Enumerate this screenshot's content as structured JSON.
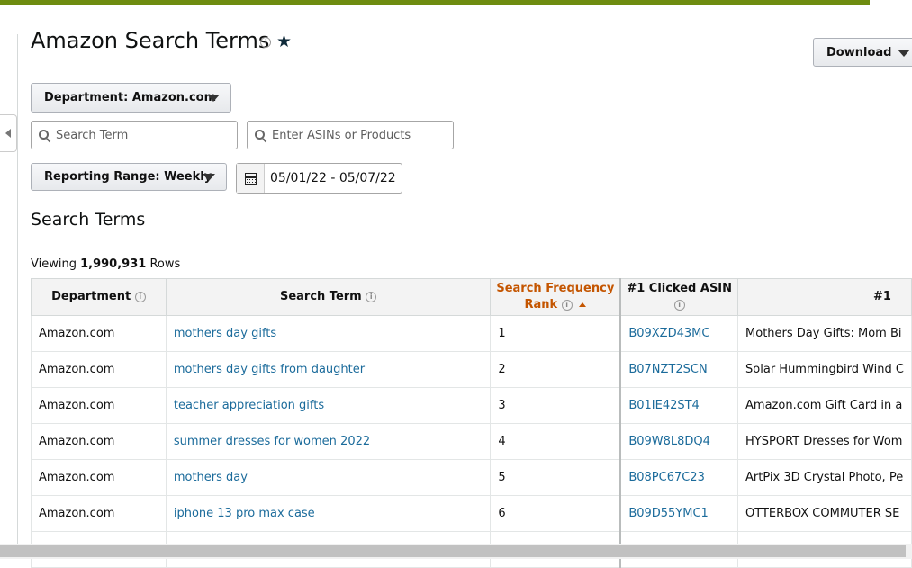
{
  "page": {
    "title": "Amazon Search Terms",
    "info_glyph": "i",
    "star_glyph": "★"
  },
  "toolbar": {
    "download_label": "Download"
  },
  "filters": {
    "department_label": "Department: Amazon.com",
    "search_term_placeholder": "Search Term",
    "asin_placeholder": "Enter ASINs or Products",
    "reporting_range_label": "Reporting Range: Weekly",
    "date_range": "05/01/22 - 05/07/22"
  },
  "section": {
    "title": "Search Terms",
    "viewing_prefix": "Viewing",
    "row_count": "1,990,931",
    "viewing_suffix": "Rows"
  },
  "table": {
    "headers": {
      "department": "Department",
      "search_term": "Search Term",
      "sfr_line1": "Search Frequency",
      "sfr_line2": "Rank",
      "clicked_asin": "#1 Clicked ASIN",
      "next_col": "#1"
    },
    "rows": [
      {
        "department": "Amazon.com",
        "term": "mothers day gifts",
        "rank": "1",
        "asin": "B09XZD43MC",
        "title": "Mothers Day Gifts: Mom Bi"
      },
      {
        "department": "Amazon.com",
        "term": "mothers day gifts from daughter",
        "rank": "2",
        "asin": "B07NZT2SCN",
        "title": "Solar Hummingbird Wind C"
      },
      {
        "department": "Amazon.com",
        "term": "teacher appreciation gifts",
        "rank": "3",
        "asin": "B01IE42ST4",
        "title": "Amazon.com Gift Card in a"
      },
      {
        "department": "Amazon.com",
        "term": "summer dresses for women 2022",
        "rank": "4",
        "asin": "B09W8L8DQ4",
        "title": "HYSPORT Dresses for Wom"
      },
      {
        "department": "Amazon.com",
        "term": "mothers day",
        "rank": "5",
        "asin": "B08PC67C23",
        "title": "ArtPix 3D Crystal Photo, Pe"
      },
      {
        "department": "Amazon.com",
        "term": "iphone 13 pro max case",
        "rank": "6",
        "asin": "B09D55YMC1",
        "title": "OTTERBOX COMMUTER SE"
      }
    ]
  },
  "colors": {
    "brand_bar": "#6e8c10",
    "link": "#1b6b9b",
    "sorted_header": "#c45500"
  }
}
